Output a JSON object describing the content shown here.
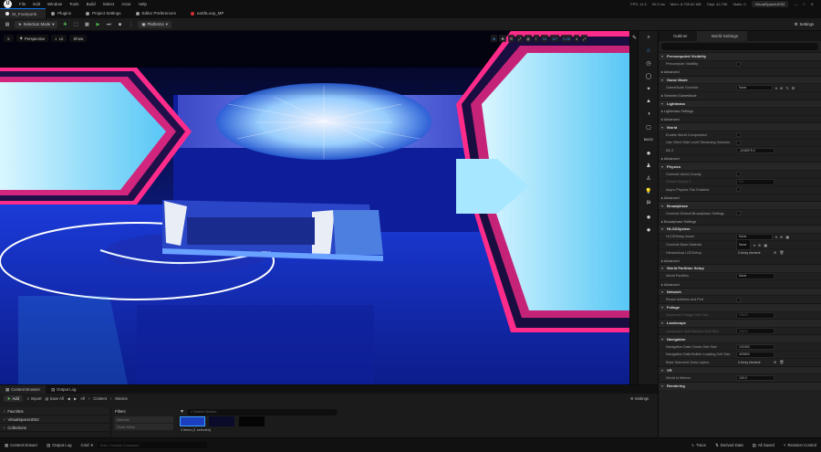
{
  "menubar": {
    "items": [
      "File",
      "Edit",
      "Window",
      "Tools",
      "Build",
      "Select",
      "Actor",
      "Help"
    ],
    "stats": [
      "FPS: 11.3",
      "90.0 ms",
      "Mem: 8,759.60 MB",
      "Objs: 42,756",
      "Stalls: 0"
    ],
    "project": "VirtualSpaceUE53"
  },
  "tabs": [
    {
      "label": "St_FoxSports",
      "color": "#e8e8e8"
    },
    {
      "label": "Plugins",
      "color": "#cfcfcf"
    },
    {
      "label": "Project Settings",
      "color": "#cfcfcf"
    },
    {
      "label": "Editor Preferences",
      "color": "#cfcfcf"
    },
    {
      "label": "earthLoop_MP",
      "color": "#d23030"
    }
  ],
  "toolbar": {
    "selection_mode": "Selection Mode",
    "platforms": "Platforms",
    "settings": "Settings"
  },
  "viewport": {
    "perspective": "Perspective",
    "lit": "Lit",
    "show": "Show",
    "right_controls": [
      "10",
      "10°",
      "0.25",
      "4"
    ]
  },
  "placement_items": [
    "BASIC",
    "LIGHTS",
    "SHAPES",
    "VISUAL",
    "VOLUMES"
  ],
  "details": {
    "tabs": [
      "Outliner",
      "World Settings"
    ],
    "sections": [
      {
        "title": "Precomputed Visibility",
        "rows": [
          {
            "label": "Precompute Visibility",
            "type": "check"
          },
          {
            "label": "Advanced",
            "type": "sub"
          }
        ]
      },
      {
        "title": "Game Mode",
        "rows": [
          {
            "label": "GameMode Override",
            "type": "dropdown",
            "value": "None"
          },
          {
            "label": "Selected GameMode",
            "type": "sub"
          }
        ]
      },
      {
        "title": "Lightmass",
        "rows": [
          {
            "label": "Lightmass Settings",
            "type": "sub"
          },
          {
            "label": "Advanced",
            "type": "sub"
          }
        ]
      },
      {
        "title": "World",
        "rows": [
          {
            "label": "Enable World Composition",
            "type": "check"
          },
          {
            "label": "Use Client Side Level Streaming Volumes",
            "type": "check"
          },
          {
            "label": "Kill Z",
            "type": "field",
            "value": "-1048575.0"
          },
          {
            "label": "Advanced",
            "type": "sub"
          }
        ]
      },
      {
        "title": "Physics",
        "rows": [
          {
            "label": "Override World Gravity",
            "type": "check"
          },
          {
            "label": "Global Gravity Z",
            "type": "field",
            "value": "0.0",
            "disabled": true
          },
          {
            "label": "Async Physics Tick Enabled",
            "type": "check"
          },
          {
            "label": "Advanced",
            "type": "sub"
          }
        ]
      },
      {
        "title": "Broadphase",
        "rows": [
          {
            "label": "Override Default Broadphase Settings",
            "type": "check"
          },
          {
            "label": "Broadphase Settings",
            "type": "sub"
          }
        ]
      },
      {
        "title": "HLODSystem",
        "rows": [
          {
            "label": "HLODSetup Asset",
            "type": "asset",
            "value": "None"
          },
          {
            "label": "Override Base Material",
            "type": "material",
            "value": "None"
          },
          {
            "label": "Hierarchical LODSetup",
            "type": "array",
            "value": "0 Array element"
          },
          {
            "label": "Advanced",
            "type": "sub"
          }
        ]
      },
      {
        "title": "World Partition Setup",
        "rows": [
          {
            "label": "World Partition",
            "type": "field",
            "value": "None"
          },
          {
            "label": "Advanced",
            "type": "sub"
          }
        ]
      },
      {
        "title": "Network",
        "rows": [
          {
            "label": "Reuse Address and Port",
            "type": "check"
          }
        ]
      },
      {
        "title": "Foliage",
        "rows": [
          {
            "label": "Instanced Foliage Grid Size",
            "type": "field",
            "value": "25600",
            "disabled": true
          }
        ]
      },
      {
        "title": "Landscape",
        "rows": [
          {
            "label": "Landscape Split Meshes Grid Size",
            "type": "field",
            "value": "25600",
            "disabled": true
          }
        ]
      },
      {
        "title": "Navigation",
        "rows": [
          {
            "label": "Navigation Data Chunk Grid Size",
            "type": "field",
            "value": "102400"
          },
          {
            "label": "Navigation Data Builder Loading Cell Size",
            "type": "field",
            "value": "409600"
          },
          {
            "label": "Base Navmesh Data Layers",
            "type": "array",
            "value": "0 Array element"
          }
        ]
      },
      {
        "title": "VR",
        "rows": [
          {
            "label": "World to Meters",
            "type": "field",
            "value": "100.0"
          }
        ]
      },
      {
        "title": "Rendering",
        "rows": []
      }
    ]
  },
  "content_browser": {
    "tabs": [
      "Content Browser",
      "Output Log"
    ],
    "add": "Add",
    "import": "Import",
    "save_all": "Save All",
    "breadcrumbs": [
      "All",
      "Content",
      "Movies"
    ],
    "settings": "Settings",
    "sources": [
      "Favorites",
      "VirtualSpaceUE53",
      "Collections"
    ],
    "filters_title": "Filters",
    "filters": [
      "Material",
      "Static Mesh"
    ],
    "search_placeholder": "Search Movies",
    "item_count": "3 items (1 selected)"
  },
  "statusbar": {
    "content_drawer": "Content Drawer",
    "output_log": "Output Log",
    "cmd": "Cmd",
    "cmd_placeholder": "Enter Console Command",
    "trace": "Trace",
    "derived_data": "Derived Data",
    "all_saved": "All Saved",
    "revision_control": "Revision Control"
  },
  "colors": {
    "accent": "#0a73e8",
    "play": "#4cc24c",
    "neon_pink": "#ff2b8a",
    "screen_cyan": "#7fd8ff"
  }
}
